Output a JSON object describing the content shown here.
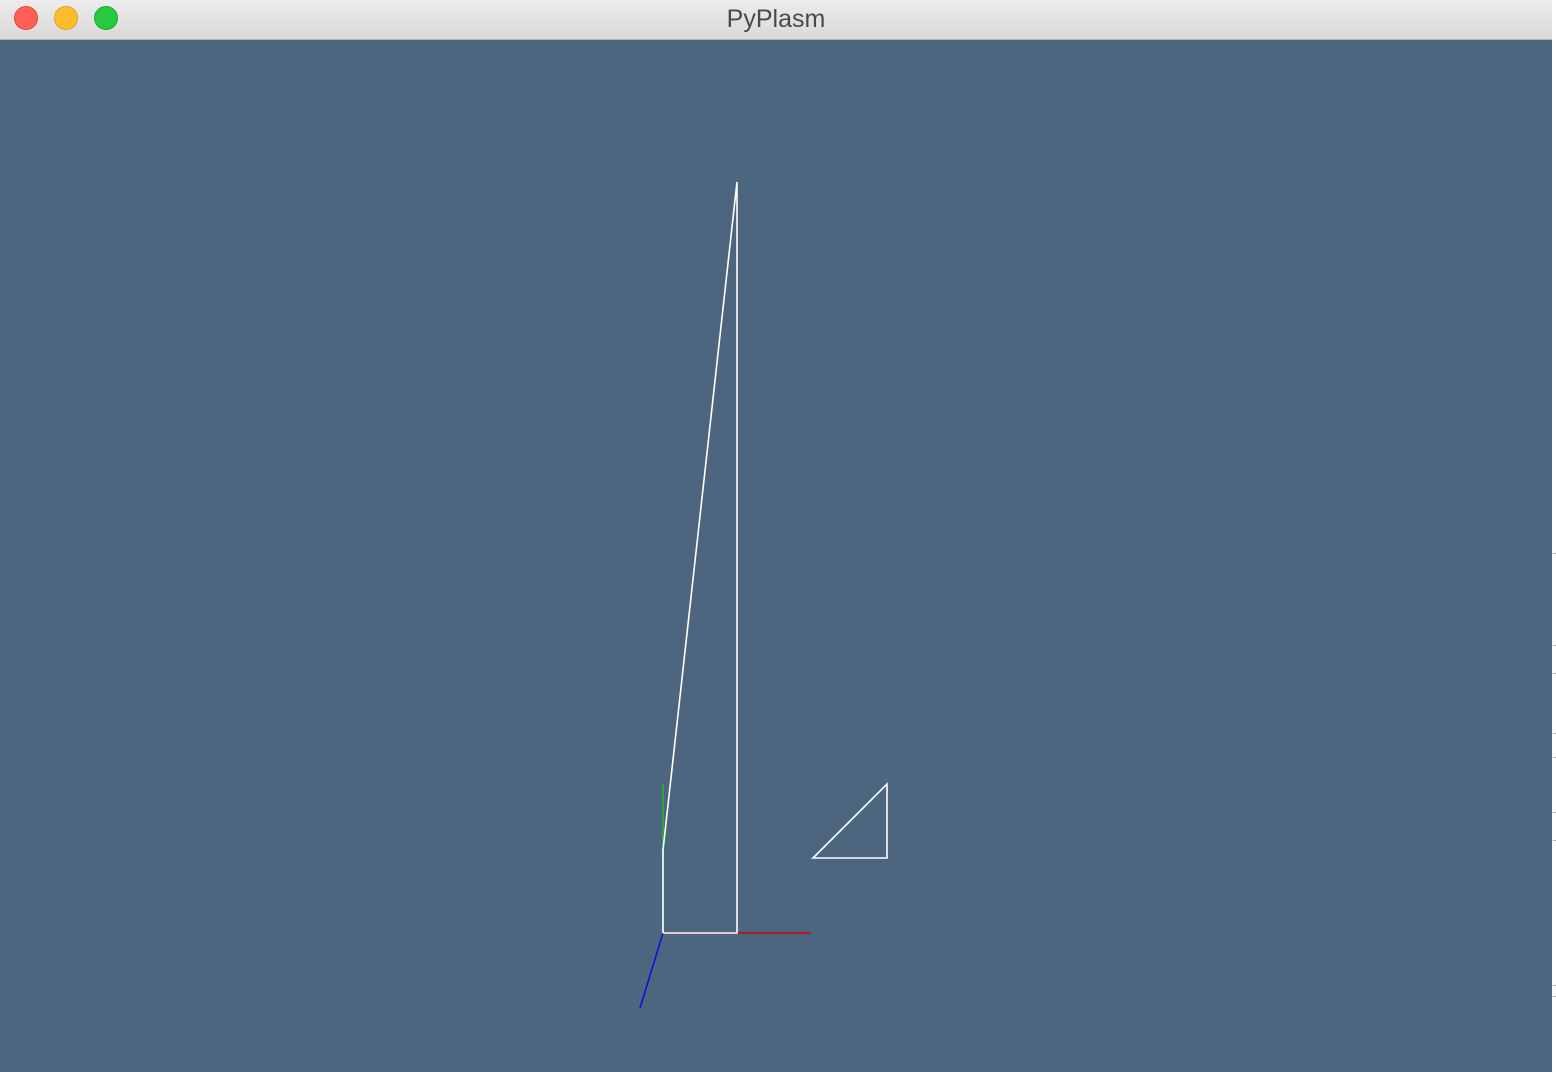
{
  "window": {
    "title": "PyPlasm"
  },
  "viewport": {
    "background_color": "#4c6680",
    "geometry_color": "#ffffff",
    "axes": {
      "x_color": "#d0000f",
      "y_color": "#22b422",
      "z_color": "#1010e0"
    }
  }
}
